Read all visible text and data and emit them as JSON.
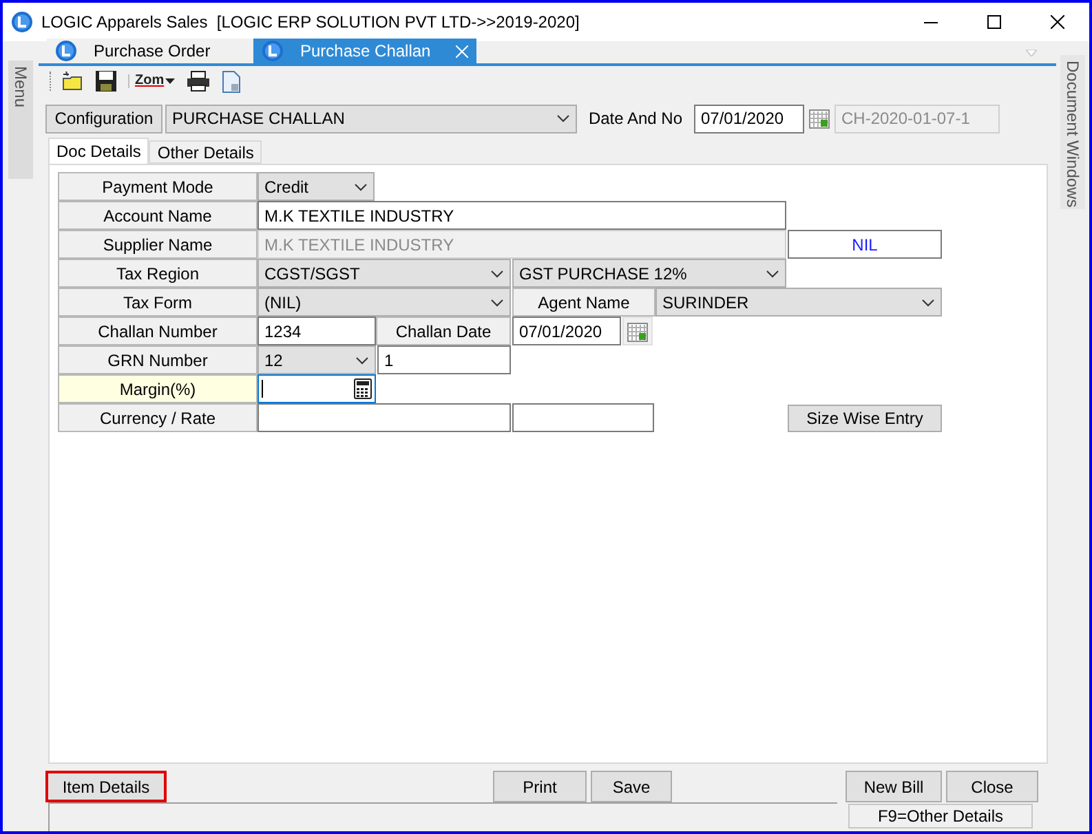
{
  "window": {
    "title": "LOGIC Apparels Sales  [LOGIC ERP SOLUTION PVT LTD->>2019-2020]"
  },
  "side_panels": {
    "left": "Menu",
    "right": "Document Windows"
  },
  "tabs": [
    {
      "label": "Purchase Order",
      "selected": false,
      "closable": false
    },
    {
      "label": "Purchase Challan",
      "selected": true,
      "closable": true
    }
  ],
  "toolbar": [
    {
      "kind": "new"
    },
    {
      "kind": "save"
    },
    {
      "kind": "zoom",
      "label": "Zom"
    },
    {
      "kind": "print"
    },
    {
      "kind": "document"
    }
  ],
  "header": {
    "configuration_button": "Configuration",
    "configuration": "PURCHASE CHALLAN",
    "date_label": "Date And No",
    "date": "07/01/2020",
    "number": "CH-2020-01-07-1"
  },
  "doc_tabs": [
    {
      "label": "Doc Details",
      "selected": true
    },
    {
      "label": "Other Details",
      "selected": false
    }
  ],
  "form_rows": [
    {
      "cells": [
        {
          "kind": "label",
          "text": "Payment Mode"
        },
        {
          "kind": "select",
          "value": "Credit"
        }
      ]
    },
    {
      "cells": [
        {
          "kind": "label",
          "text": "Account Name"
        },
        {
          "kind": "input",
          "value": "M.K TEXTILE INDUSTRY"
        }
      ]
    },
    {
      "cells": [
        {
          "kind": "label",
          "text": "Supplier Name"
        },
        {
          "kind": "input",
          "value": "M.K TEXTILE INDUSTRY",
          "disabled": true
        },
        {
          "kind": "badge",
          "text": "NIL"
        }
      ]
    },
    {
      "cells": [
        {
          "kind": "label",
          "text": "Tax Region"
        },
        {
          "kind": "select",
          "value": "CGST/SGST"
        },
        {
          "kind": "select",
          "value": "GST PURCHASE 12%"
        }
      ]
    },
    {
      "cells": [
        {
          "kind": "label",
          "text": "Tax Form"
        },
        {
          "kind": "select",
          "value": "(NIL)"
        },
        {
          "kind": "label",
          "text": "Agent Name"
        },
        {
          "kind": "select",
          "value": "SURINDER"
        }
      ]
    },
    {
      "cells": [
        {
          "kind": "label",
          "text": "Challan Number"
        },
        {
          "kind": "input",
          "value": "1234"
        },
        {
          "kind": "label",
          "text": "Challan Date"
        },
        {
          "kind": "input",
          "value": "07/01/2020"
        },
        {
          "kind": "calendar"
        }
      ]
    },
    {
      "cells": [
        {
          "kind": "label",
          "text": "GRN Number"
        },
        {
          "kind": "select",
          "value": "12"
        },
        {
          "kind": "input",
          "value": "1"
        }
      ]
    },
    {
      "cells": [
        {
          "kind": "label",
          "text": "Margin(%)",
          "highlighted": true
        },
        {
          "kind": "calc_input",
          "focused": true
        }
      ]
    },
    {
      "cells": [
        {
          "kind": "label",
          "text": "Currency / Rate"
        },
        {
          "kind": "input"
        },
        {
          "kind": "input"
        },
        {
          "kind": "button",
          "text": "Size Wise Entry"
        }
      ]
    }
  ],
  "bottom_buttons": [
    {
      "label": "Item Details",
      "highlighted": true
    },
    {
      "label": "Print",
      "highlighted": false
    },
    {
      "label": "Save",
      "highlighted": false
    },
    {
      "label": "New Bill",
      "highlighted": false
    },
    {
      "label": "Close",
      "highlighted": false
    }
  ],
  "status_hint": "F9=Other Details"
}
